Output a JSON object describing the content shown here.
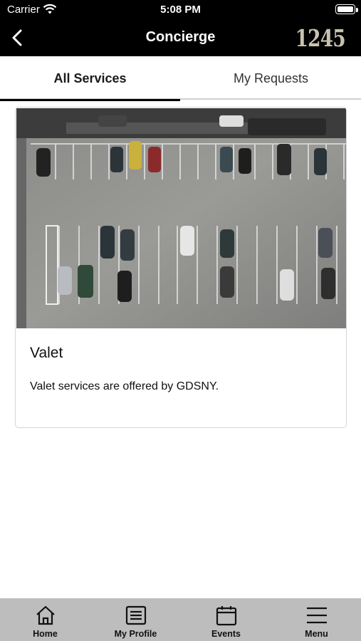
{
  "status_bar": {
    "carrier": "Carrier",
    "time": "5:08 PM"
  },
  "nav": {
    "title": "Concierge",
    "logo_text": "1245",
    "back_icon": "chevron-left-icon"
  },
  "tabs": [
    {
      "label": "All Services",
      "active": true
    },
    {
      "label": "My Requests",
      "active": false
    }
  ],
  "services": [
    {
      "title": "Valet",
      "description": "Valet services are offered by GDSNY.",
      "image": "aerial parking lot photo"
    }
  ],
  "tab_bar": {
    "items": [
      {
        "label": "Home",
        "icon": "home-icon"
      },
      {
        "label": "My Profile",
        "icon": "profile-card-icon"
      },
      {
        "label": "Events",
        "icon": "calendar-icon"
      },
      {
        "label": "Menu",
        "icon": "hamburger-menu-icon"
      }
    ]
  },
  "colors": {
    "header_bg": "#000000",
    "tab_bar_bg": "#bdbdbd",
    "logo": "#c8c2b0"
  }
}
